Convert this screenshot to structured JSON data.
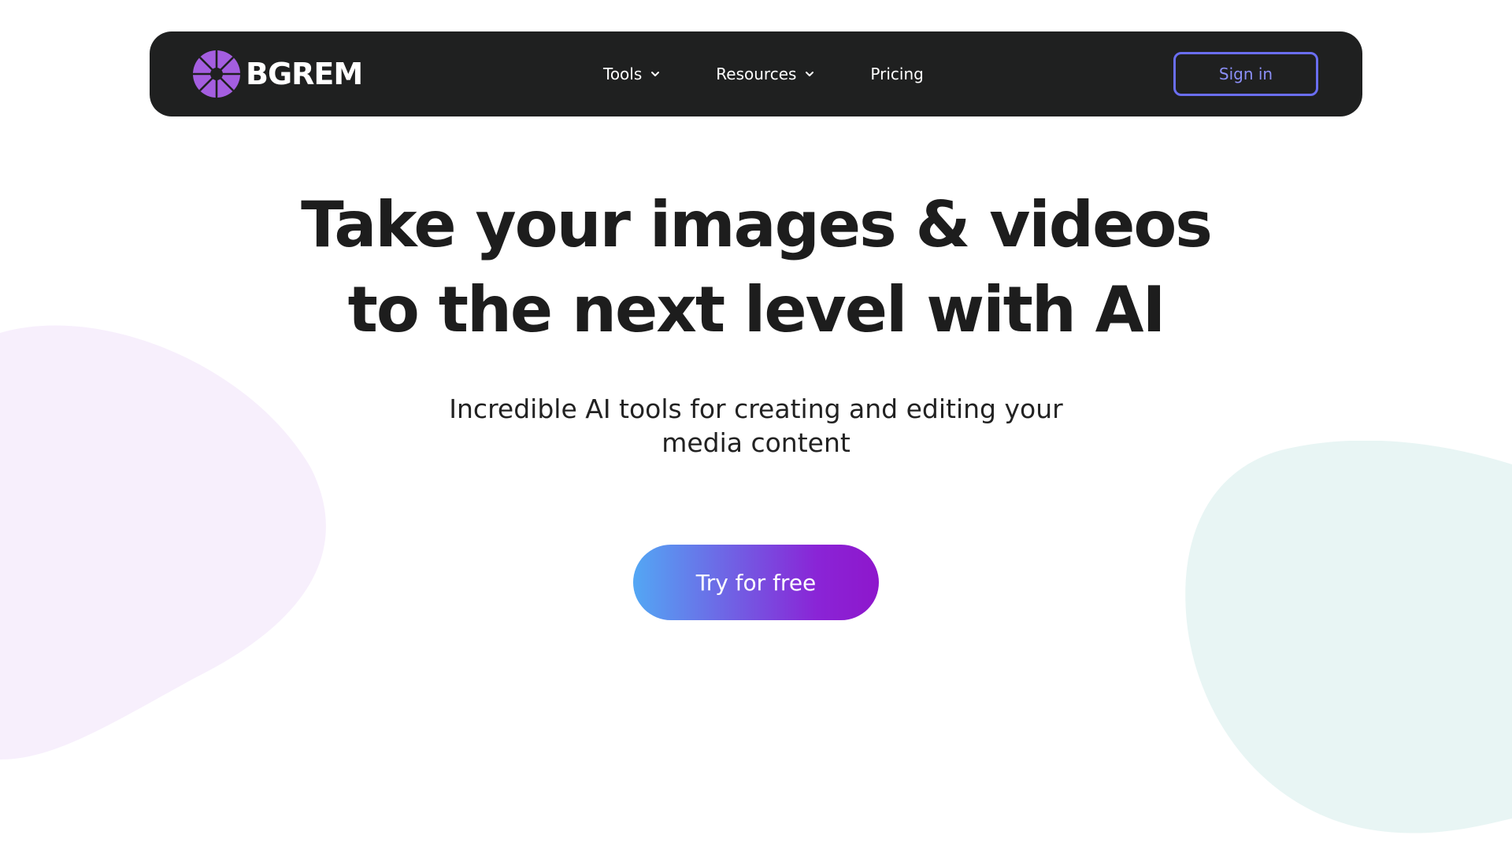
{
  "colors": {
    "navbar_bg": "#1f2020",
    "accent_outline": "#6a6ef2",
    "logo_purple": "#a45ee0",
    "cta_gradient_start": "#53a7f4",
    "cta_gradient_end": "#8e17cc",
    "blob_left": "#f7effc",
    "blob_right": "#e8f5f4",
    "heading_text": "#1d1d1d"
  },
  "navbar": {
    "logo": {
      "icon": "aperture-icon",
      "text": "BGREM"
    },
    "links": [
      {
        "label": "Tools",
        "icon": "chevron-down-icon"
      },
      {
        "label": "Resources",
        "icon": "chevron-down-icon"
      },
      {
        "label": "Pricing"
      }
    ],
    "sign_in_label": "Sign in"
  },
  "hero": {
    "title_lines": [
      "Take your images & videos",
      "to the next level with AI"
    ],
    "subtitle_lines": [
      "Incredible AI tools for creating and editing your",
      "media content"
    ],
    "cta_label": "Try for free"
  }
}
